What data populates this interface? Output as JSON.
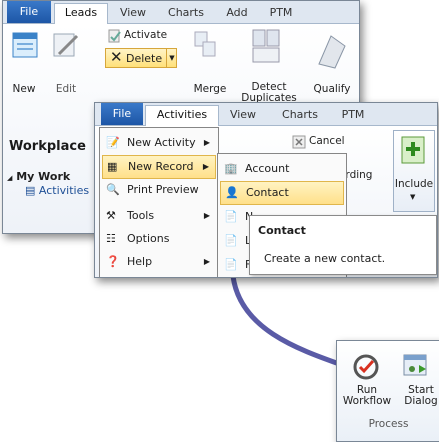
{
  "back_window": {
    "tabs": [
      "File",
      "Leads",
      "View",
      "Charts",
      "Add",
      "PTM"
    ],
    "buttons": {
      "new": "New",
      "edit": "Edit",
      "activate": "Activate",
      "delete": "Delete",
      "merge": "Merge",
      "detect": "Detect",
      "duplicates": "Duplicates",
      "qualify": "Qualify"
    },
    "workplace": "Workplace",
    "my_work": "My Work",
    "activities": "Activities"
  },
  "front_window": {
    "tabs": [
      "File",
      "Activities",
      "View",
      "Charts",
      "PTM"
    ],
    "buttons": {
      "cancel": "Cancel",
      "regarding": "arding",
      "include": "Include"
    },
    "menu": [
      {
        "label": "New Activity",
        "icon": "new-activity-icon",
        "submenu": true
      },
      {
        "label": "New Record",
        "icon": "new-record-icon",
        "submenu": true
      },
      {
        "label": "Print Preview",
        "icon": "print-preview-icon",
        "submenu": false
      },
      {
        "label": "Tools",
        "icon": "tools-icon",
        "submenu": true
      },
      {
        "label": "Options",
        "icon": "options-icon",
        "submenu": false
      },
      {
        "label": "Help",
        "icon": "help-icon",
        "submenu": true
      }
    ],
    "submenu": [
      {
        "label": "Account",
        "icon": "account-icon"
      },
      {
        "label": "Contact",
        "icon": "contact-icon"
      }
    ],
    "partial_items": [
      "N",
      "L",
      "F"
    ],
    "tooltip": {
      "title": "Contact",
      "description": "Create a new contact."
    }
  },
  "process_panel": {
    "run": "Run",
    "workflow": "Workflow",
    "start": "Start",
    "dialog": "Dialog",
    "group": "Process"
  },
  "colors": {
    "file_tab": "#2a66b8",
    "highlight": "#ffe08a",
    "connector": "#5a5ba6"
  }
}
